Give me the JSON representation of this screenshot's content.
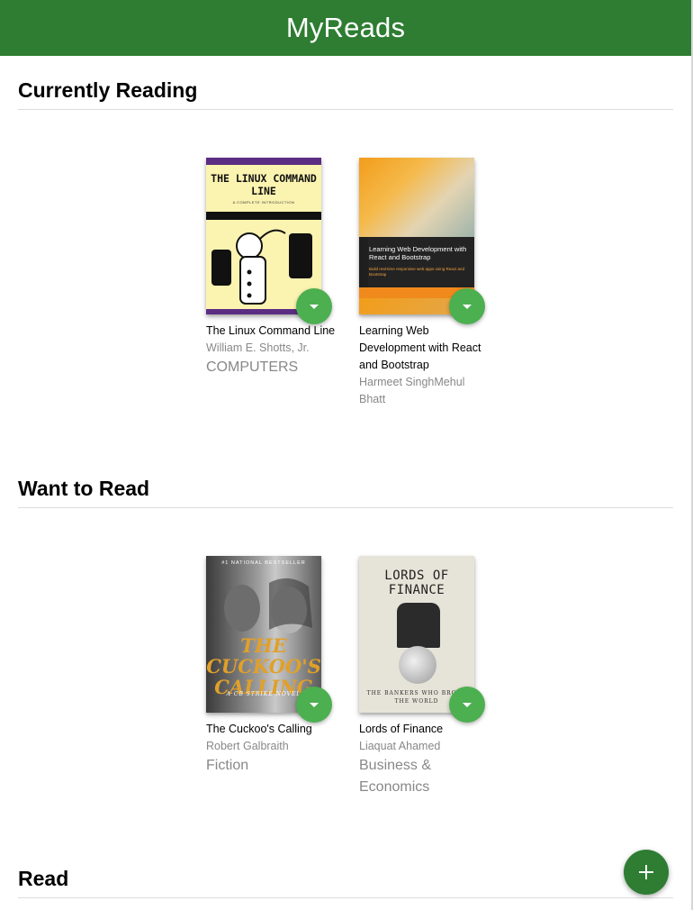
{
  "app": {
    "title": "MyReads"
  },
  "shelves": [
    {
      "title": "Currently Reading",
      "books": [
        {
          "title": "The Linux Command Line",
          "authors": "William E. Shotts, Jr.",
          "category": "COMPUTERS",
          "cover": {
            "title": "THE LINUX COMMAND LINE",
            "subtitle": "A COMPLETE INTRODUCTION"
          }
        },
        {
          "title": "Learning Web Development with React and Bootstrap",
          "authors": "Harmeet SinghMehul Bhatt",
          "category": "",
          "cover": {
            "title": "Learning Web Development with React and Bootstrap",
            "subtitle": "Build real-time responsive web apps using React and Bootstrap"
          }
        }
      ]
    },
    {
      "title": "Want to Read",
      "books": [
        {
          "title": "The Cuckoo's Calling",
          "authors": "Robert Galbraith",
          "category": "Fiction",
          "cover": {
            "title": "THE CUCKOO'S CALLING",
            "top": "#1 NATIONAL BESTSELLER",
            "subtitle": "A CB STRIKE NOVEL"
          }
        },
        {
          "title": "Lords of Finance",
          "authors": "Liaquat Ahamed",
          "category": "Business & Economics",
          "cover": {
            "title": "LORDS OF FINANCE",
            "subtitle": "THE BANKERS WHO BROKE THE WORLD"
          }
        }
      ]
    },
    {
      "title": "Read",
      "books": []
    }
  ],
  "colors": {
    "header": "#2e7d32",
    "shelf_changer": "#4caf50",
    "add_button": "#2e7d32"
  },
  "icons": {
    "shelf_changer": "caret-down-icon",
    "add_button": "plus-icon"
  }
}
